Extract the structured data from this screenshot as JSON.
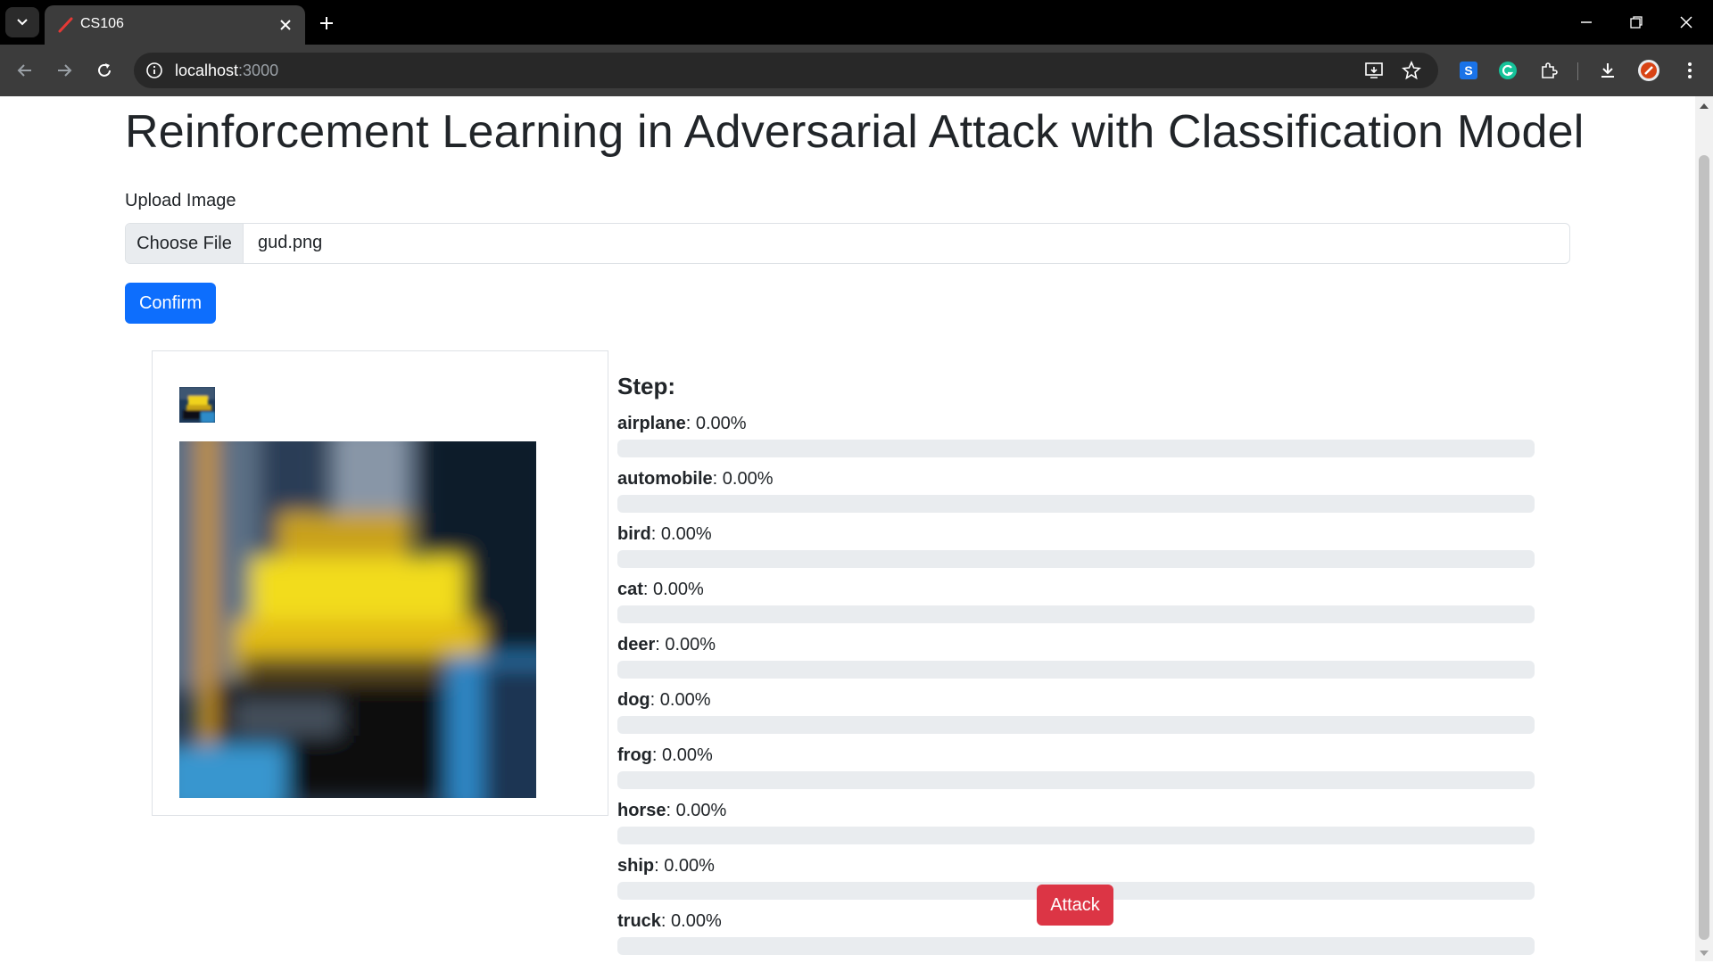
{
  "browser": {
    "tab_title": "CS106",
    "url_host": "localhost",
    "url_port": ":3000"
  },
  "page": {
    "title": "Reinforcement Learning in Adversarial Attack with Classification Model",
    "upload_label": "Upload Image",
    "choose_file_label": "Choose File",
    "file_name": "gud.png",
    "confirm_label": "Confirm",
    "step_label": "Step:",
    "attack_label": "Attack"
  },
  "predictions": [
    {
      "name": "airplane",
      "value": "0.00%",
      "fraction": 0
    },
    {
      "name": "automobile",
      "value": "0.00%",
      "fraction": 0
    },
    {
      "name": "bird",
      "value": "0.00%",
      "fraction": 0
    },
    {
      "name": "cat",
      "value": "0.00%",
      "fraction": 0
    },
    {
      "name": "deer",
      "value": "0.00%",
      "fraction": 0
    },
    {
      "name": "dog",
      "value": "0.00%",
      "fraction": 0
    },
    {
      "name": "frog",
      "value": "0.00%",
      "fraction": 0
    },
    {
      "name": "horse",
      "value": "0.00%",
      "fraction": 0
    },
    {
      "name": "ship",
      "value": "0.00%",
      "fraction": 0
    },
    {
      "name": "truck",
      "value": "0.00%",
      "fraction": 0
    }
  ],
  "colors": {
    "primary": "#0d6efd",
    "danger": "#dc3545",
    "progress_track": "#e9ecef"
  }
}
